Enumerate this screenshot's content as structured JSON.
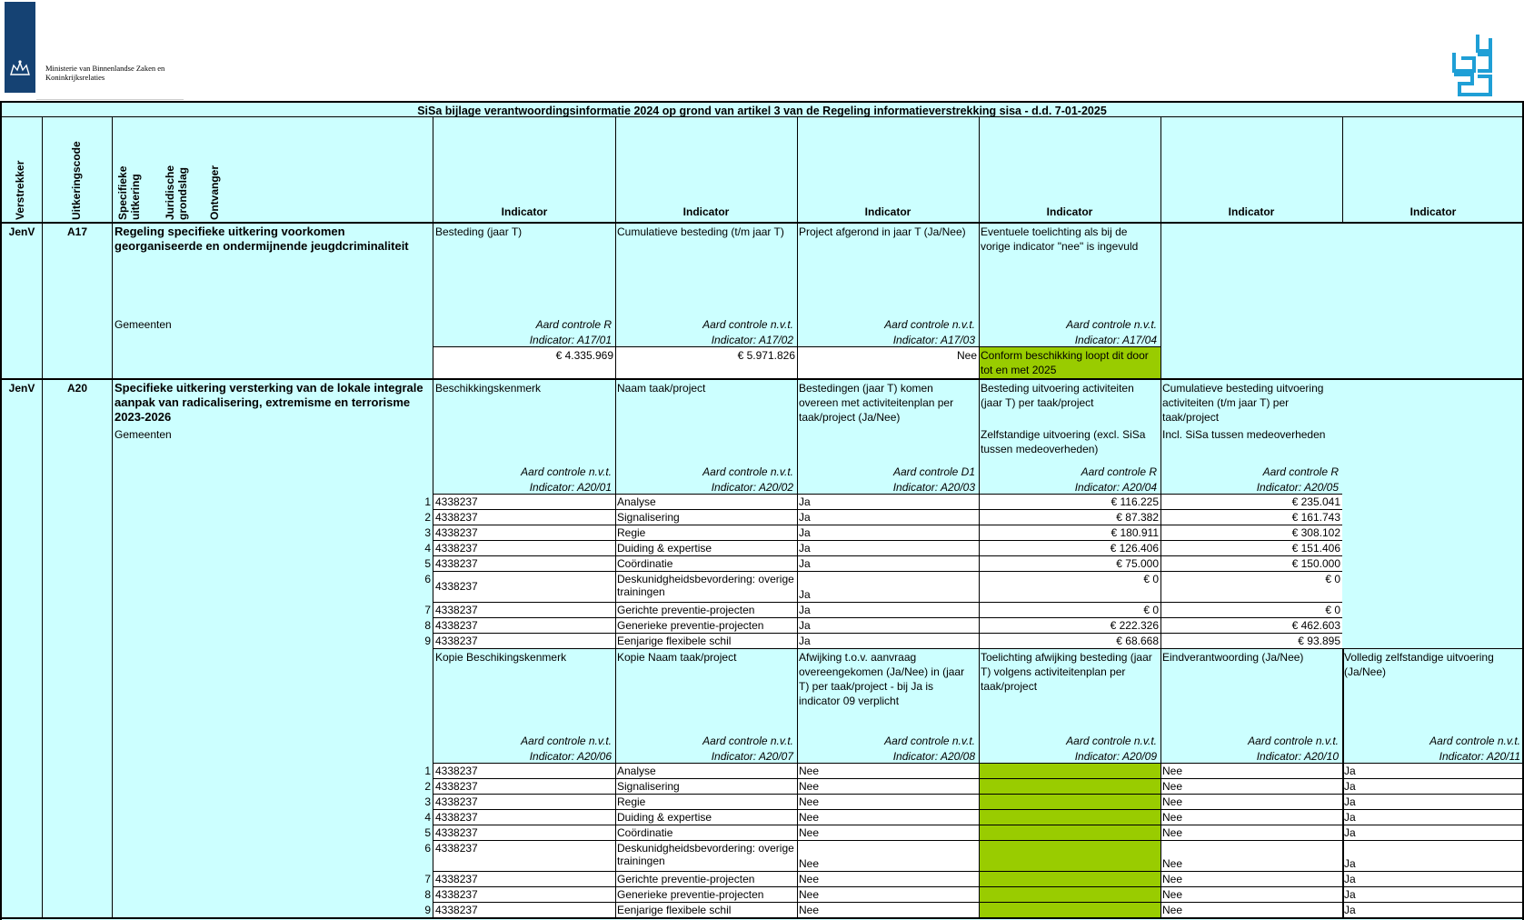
{
  "header": {
    "ministry_logo_text": "Ministerie van Binnenlandse Zaken en Koninkrijksrelaties",
    "cbs_logo": "cbs",
    "title": "SiSa bijlage verantwoordingsinformatie 2024 op grond van artikel 3 van de Regeling informatieverstrekking sisa - d.d. 7-01-2025"
  },
  "columns": {
    "verstrekker": "Verstrekker",
    "uitkeringscode": "Uitkeringscode",
    "specifieke": "Specifieke uitkering",
    "juridische": "Juridische grondslag",
    "ontvanger": "Ontvanger",
    "indicator": "Indicator"
  },
  "a17": {
    "verstrekker": "JenV",
    "code": "A17",
    "name": "Regeling specifieke uitkering voorkomen georganiseerde en ondermijnende jeugdcriminaliteit",
    "ontvanger": "Gemeenten",
    "ind": [
      {
        "label": "Besteding (jaar T)",
        "aard": "Aard controle R",
        "code": "Indicator: A17/01",
        "value": "€ 4.335.969"
      },
      {
        "label": "Cumulatieve besteding (t/m jaar T)",
        "aard": "Aard controle n.v.t.",
        "code": "Indicator: A17/02",
        "value": "€ 5.971.826"
      },
      {
        "label": "Project afgerond in jaar T (Ja/Nee)",
        "aard": "Aard controle n.v.t.",
        "code": "Indicator: A17/03",
        "value": "Nee"
      },
      {
        "label": "Eventuele toelichting als bij de vorige indicator \"nee\" is ingevuld",
        "aard": "Aard controle n.v.t.",
        "code": "Indicator: A17/04",
        "value": "Conform beschikking loopt dit door tot en met 2025"
      }
    ]
  },
  "a20": {
    "verstrekker": "JenV",
    "code": "A20",
    "name": "Specifieke uitkering versterking van de lokale integrale aanpak van radicalisering, extremisme en terrorisme 2023-2026",
    "ontvanger": "Gemeenten",
    "ind1": [
      {
        "label": "Beschikkingskenmerk",
        "aard": "Aard controle n.v.t.",
        "code": "Indicator: A20/01"
      },
      {
        "label": "Naam taak/project",
        "aard": "Aard controle n.v.t.",
        "code": "Indicator: A20/02"
      },
      {
        "label": "Bestedingen (jaar T) komen overeen met activiteitenplan per taak/project (Ja/Nee)",
        "aard": "Aard controle D1",
        "code": "Indicator: A20/03"
      },
      {
        "label": "Besteding uitvoering activiteiten (jaar T) per taak/project",
        "label2": "Zelfstandige uitvoering (excl. SiSa tussen medeoverheden)",
        "aard": "Aard controle R",
        "code": "Indicator: A20/04"
      },
      {
        "label": "Cumulatieve besteding uitvoering activiteiten (t/m jaar T) per taak/project",
        "label2": "Incl. SiSa tussen medeoverheden",
        "aard": "Aard controle R",
        "code": "Indicator: A20/05"
      }
    ],
    "rows1": [
      {
        "n": "1",
        "k": "4338237",
        "naam": "Analyse",
        "ja": "Ja",
        "bes": "€ 116.225",
        "cum": "€ 235.041"
      },
      {
        "n": "2",
        "k": "4338237",
        "naam": "Signalisering",
        "ja": "Ja",
        "bes": "€ 87.382",
        "cum": "€ 161.743"
      },
      {
        "n": "3",
        "k": "4338237",
        "naam": "Regie",
        "ja": "Ja",
        "bes": "€ 180.911",
        "cum": "€ 308.102"
      },
      {
        "n": "4",
        "k": "4338237",
        "naam": "Duiding & expertise",
        "ja": "Ja",
        "bes": "€ 126.406",
        "cum": "€ 151.406"
      },
      {
        "n": "5",
        "k": "4338237",
        "naam": "Coördinatie",
        "ja": "Ja",
        "bes": "€ 75.000",
        "cum": "€ 150.000"
      },
      {
        "n": "6",
        "k": "4338237",
        "naam": "Deskunidgheidsbevordering: overige trainingen",
        "ja": "Ja",
        "bes": "€ 0",
        "cum": "€ 0"
      },
      {
        "n": "7",
        "k": "4338237",
        "naam": "Gerichte preventie-projecten",
        "ja": "Ja",
        "bes": "€ 0",
        "cum": "€ 0"
      },
      {
        "n": "8",
        "k": "4338237",
        "naam": "Generieke preventie-projecten",
        "ja": "Ja",
        "bes": "€ 222.326",
        "cum": "€ 462.603"
      },
      {
        "n": "9",
        "k": "4338237",
        "naam": "Eenjarige flexibele schil",
        "ja": "Ja",
        "bes": "€ 68.668",
        "cum": "€ 93.895"
      }
    ],
    "ind2": [
      {
        "label": "Kopie Beschikingskenmerk",
        "aard": "Aard controle n.v.t.",
        "code": "Indicator: A20/06"
      },
      {
        "label": "Kopie Naam taak/project",
        "aard": "Aard controle n.v.t.",
        "code": "Indicator: A20/07"
      },
      {
        "label": "Afwijking t.o.v. aanvraag overeengekomen (Ja/Nee) in (jaar T) per taak/project - bij Ja is indicator 09 verplicht",
        "aard": "Aard controle n.v.t.",
        "code": "Indicator: A20/08"
      },
      {
        "label": "Toelichting afwijking besteding (jaar T) volgens activiteitenplan per taak/project",
        "aard": "Aard controle n.v.t.",
        "code": "Indicator: A20/09"
      },
      {
        "label": "Eindverantwoording (Ja/Nee)",
        "aard": "Aard controle n.v.t.",
        "code": "Indicator: A20/10"
      },
      {
        "label": "Volledig zelfstandige uitvoering (Ja/Nee)",
        "aard": "Aard controle n.v.t.",
        "code": "Indicator: A20/11"
      }
    ],
    "rows2": [
      {
        "n": "1",
        "k": "4338237",
        "naam": "Analyse",
        "afw": "Nee",
        "eind": "Nee",
        "zelf": "Ja"
      },
      {
        "n": "2",
        "k": "4338237",
        "naam": "Signalisering",
        "afw": "Nee",
        "eind": "Nee",
        "zelf": "Ja"
      },
      {
        "n": "3",
        "k": "4338237",
        "naam": "Regie",
        "afw": "Nee",
        "eind": "Nee",
        "zelf": "Ja"
      },
      {
        "n": "4",
        "k": "4338237",
        "naam": "Duiding & expertise",
        "afw": "Nee",
        "eind": "Nee",
        "zelf": "Ja"
      },
      {
        "n": "5",
        "k": "4338237",
        "naam": "Coördinatie",
        "afw": "Nee",
        "eind": "Nee",
        "zelf": "Ja"
      },
      {
        "n": "6",
        "k": "4338237",
        "naam": "Deskunidgheidsbevordering: overige trainingen",
        "afw": "Nee",
        "eind": "Nee",
        "zelf": "Ja"
      },
      {
        "n": "7",
        "k": "4338237",
        "naam": "Gerichte preventie-projecten",
        "afw": "Nee",
        "eind": "Nee",
        "zelf": "Ja"
      },
      {
        "n": "8",
        "k": "4338237",
        "naam": "Generieke preventie-projecten",
        "afw": "Nee",
        "eind": "Nee",
        "zelf": "Ja"
      },
      {
        "n": "9",
        "k": "4338237",
        "naam": "Eenjarige flexibele schil",
        "afw": "Nee",
        "eind": "Nee",
        "zelf": "Ja"
      }
    ]
  }
}
